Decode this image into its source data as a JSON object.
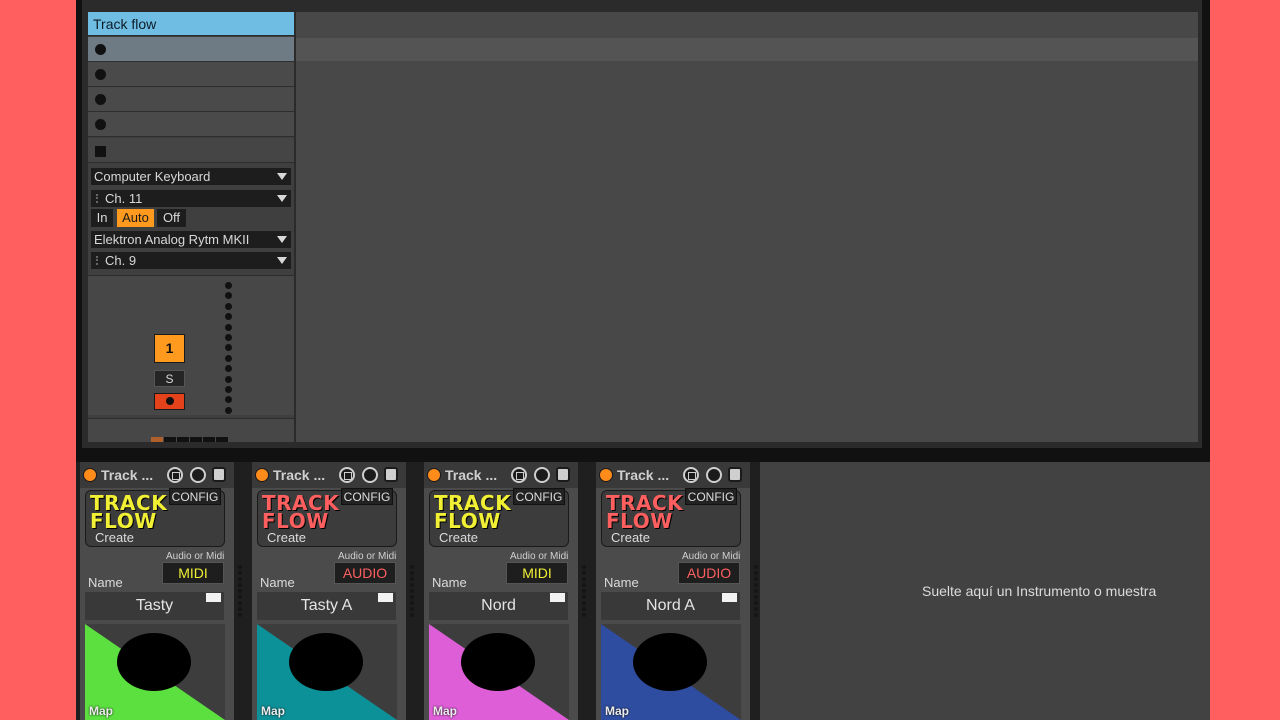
{
  "session": {
    "track_header": "Track flow",
    "input_type": "Computer Keyboard",
    "input_channel": "Ch. 11",
    "monitor": {
      "in": "In",
      "auto": "Auto",
      "off": "Off"
    },
    "output_type": "Elektron Analog Rytm MKII",
    "output_channel": "Ch. 9",
    "track_number": "1",
    "solo_label": "S"
  },
  "devices": [
    {
      "title": "Track ...",
      "logo_line1": "TRACK",
      "logo_line2": "FLOW",
      "logo_color": "#f2f034",
      "create": "Create",
      "config": "CONFIG",
      "aom": "Audio or Midi",
      "type": "MIDI",
      "type_color": "#f2f034",
      "name_label": "Name",
      "name": "Tasty",
      "map_color": "#5ce040",
      "map": "Map"
    },
    {
      "title": "Track ...",
      "logo_line1": "TRACK",
      "logo_line2": "FLOW",
      "logo_color": "#ff5f5f",
      "create": "Create",
      "config": "CONFIG",
      "aom": "Audio or Midi",
      "type": "AUDIO",
      "type_color": "#ff5f5f",
      "name_label": "Name",
      "name": "Tasty A",
      "map_color": "#0d9198",
      "map": "Map"
    },
    {
      "title": "Track ...",
      "logo_line1": "TRACK",
      "logo_line2": "FLOW",
      "logo_color": "#f2f034",
      "create": "Create",
      "config": "CONFIG",
      "aom": "Audio or Midi",
      "type": "MIDI",
      "type_color": "#f2f034",
      "name_label": "Name",
      "name": "Nord",
      "map_color": "#de5ed8",
      "map": "Map"
    },
    {
      "title": "Track ...",
      "logo_line1": "TRACK",
      "logo_line2": "FLOW",
      "logo_color": "#ff5f5f",
      "create": "Create",
      "config": "CONFIG",
      "aom": "Audio or Midi",
      "type": "AUDIO",
      "type_color": "#ff5f5f",
      "name_label": "Name",
      "name": "Nord A",
      "map_color": "#2f4da0",
      "map": "Map"
    }
  ],
  "drop_zone": {
    "text": "Suelte aquí un Instrumento o muestra"
  },
  "colors": {
    "accent": "#ff9a1e",
    "track_header": "#6fbde3",
    "arm": "#e3421b",
    "background": "#ff5f5f"
  }
}
